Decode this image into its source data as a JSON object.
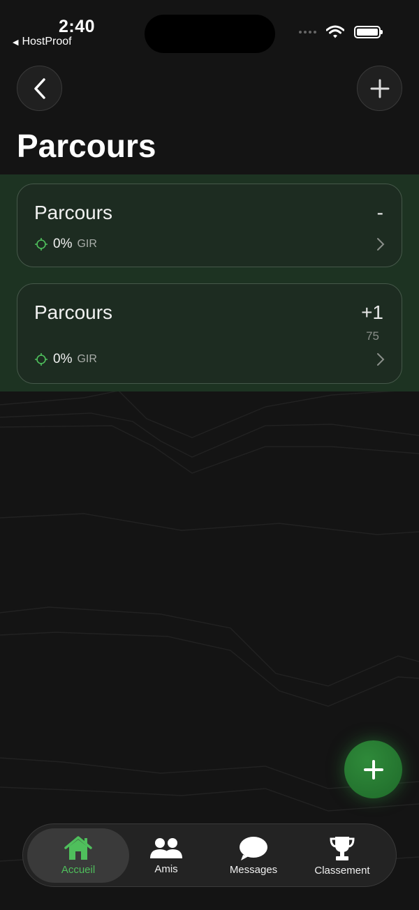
{
  "status_bar": {
    "time": "2:40",
    "back_app": "HostProof",
    "icons": [
      "cellular-dots-icon",
      "wifi-icon",
      "battery-icon"
    ]
  },
  "header": {
    "title": "Parcours",
    "back_icon": "chevron-left-icon",
    "add_icon": "plus-icon"
  },
  "courses": [
    {
      "name": "Parcours",
      "score": "-",
      "sub": "",
      "gir_pct": "0%",
      "gir_label": "GIR"
    },
    {
      "name": "Parcours",
      "score": "+1",
      "sub": "75",
      "gir_pct": "0%",
      "gir_label": "GIR"
    }
  ],
  "fab": {
    "icon": "plus-icon"
  },
  "tab_bar": {
    "tabs": [
      {
        "label": "Accueil",
        "icon": "home-icon",
        "active": true
      },
      {
        "label": "Amis",
        "icon": "friends-icon",
        "active": false
      },
      {
        "label": "Messages",
        "icon": "chat-bubble-icon",
        "active": false
      },
      {
        "label": "Classement",
        "icon": "trophy-icon",
        "active": false
      }
    ]
  },
  "colors": {
    "background": "#141414",
    "band": "#1d3322",
    "card": "#1d2c21",
    "accent": "#4fbf5c",
    "fab": "#237a30"
  }
}
